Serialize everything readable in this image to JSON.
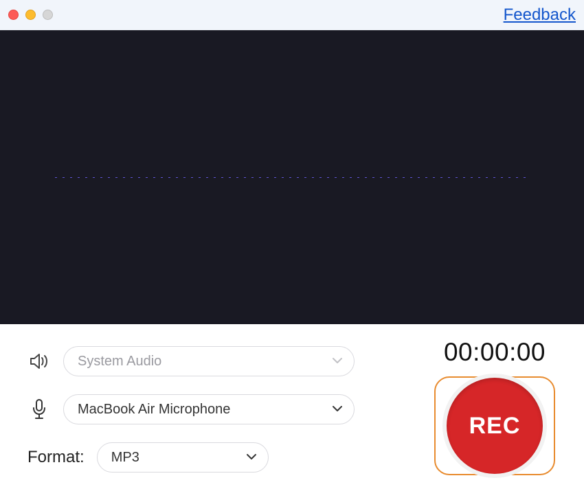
{
  "titlebar": {
    "feedback_label": "Feedback"
  },
  "audio_sources": {
    "system_audio": {
      "selected": "System Audio"
    },
    "microphone": {
      "selected": "MacBook Air Microphone"
    }
  },
  "format": {
    "label": "Format:",
    "selected": "MP3"
  },
  "timer": "00:00:00",
  "record_button": {
    "label": "REC"
  },
  "icons": {
    "speaker": "speaker",
    "microphone": "microphone",
    "chevron_down": "chevron-down"
  }
}
